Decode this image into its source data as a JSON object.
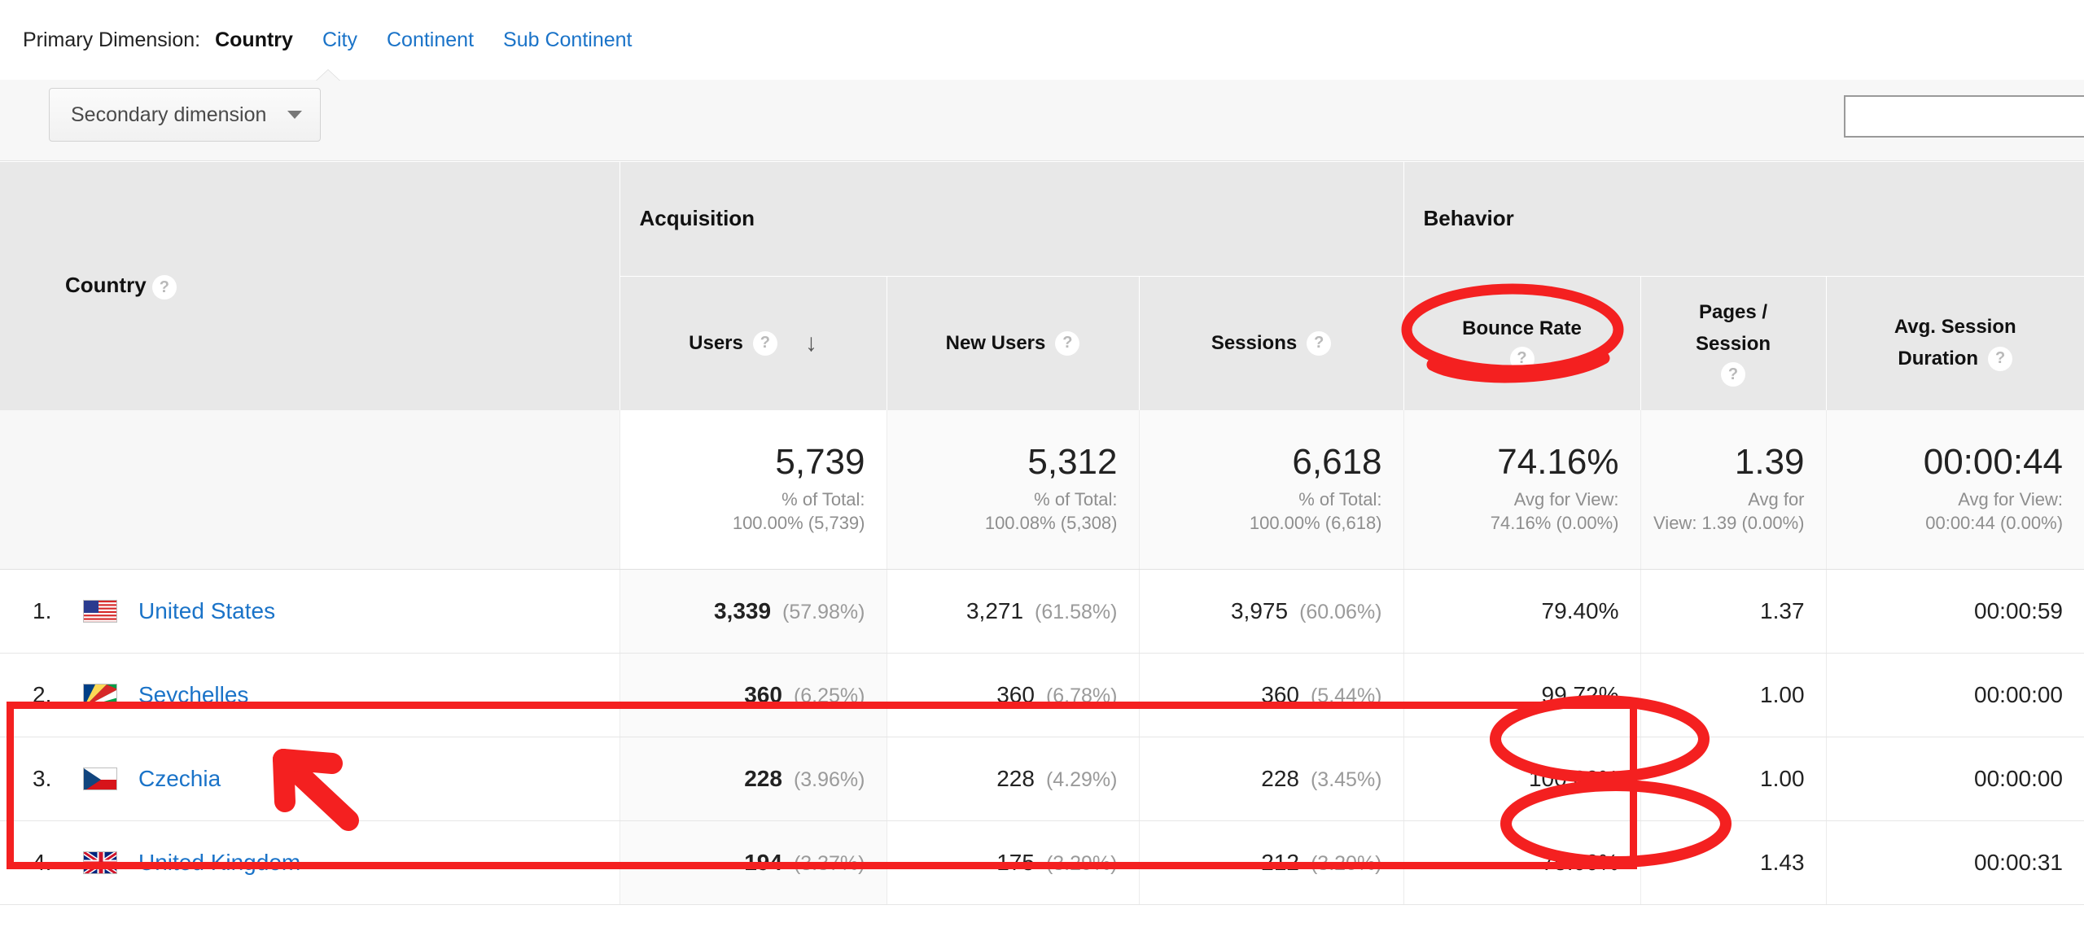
{
  "primary_dimension": {
    "label": "Primary Dimension:",
    "items": [
      {
        "label": "Country",
        "active": true
      },
      {
        "label": "City",
        "active": false
      },
      {
        "label": "Continent",
        "active": false
      },
      {
        "label": "Sub Continent",
        "active": false
      }
    ]
  },
  "toolbar": {
    "secondary_dimension_label": "Secondary dimension",
    "dropdown_icon": "chevron-down-icon",
    "search_value": "",
    "search_placeholder": ""
  },
  "table": {
    "dimension_header": "Country",
    "help_icon": "help-question-icon",
    "sort_icon": "sort-descending-arrow-icon",
    "groups": [
      {
        "label": "Acquisition",
        "span": 3
      },
      {
        "label": "Behavior",
        "span": 3
      }
    ],
    "columns": [
      {
        "label": "Users",
        "help": true,
        "sorted": true
      },
      {
        "label": "New Users",
        "help": true,
        "sorted": false
      },
      {
        "label": "Sessions",
        "help": true,
        "sorted": false
      },
      {
        "label": "Bounce Rate",
        "help": true,
        "sorted": false
      },
      {
        "label": "Pages / Session",
        "line1": "Pages /",
        "line2": "Session",
        "help": true,
        "sorted": false
      },
      {
        "label": "Avg. Session Duration",
        "line1": "Avg. Session",
        "line2": "Duration",
        "help": true,
        "sorted": false
      }
    ],
    "summary": [
      {
        "big": "5,739",
        "sub1": "% of Total:",
        "sub2": "100.00% (5,739)"
      },
      {
        "big": "5,312",
        "sub1": "% of Total:",
        "sub2": "100.08% (5,308)"
      },
      {
        "big": "6,618",
        "sub1": "% of Total:",
        "sub2": "100.00% (6,618)"
      },
      {
        "big": "74.16%",
        "sub1": "Avg for View:",
        "sub2": "74.16% (0.00%)"
      },
      {
        "big": "1.39",
        "sub1": "Avg for",
        "sub2": "View: 1.39 (0.00%)"
      },
      {
        "big": "00:00:44",
        "sub1": "Avg for View:",
        "sub2": "00:00:44 (0.00%)"
      }
    ],
    "rows": [
      {
        "rank": "1.",
        "country": "United States",
        "flag": "flag-united-states",
        "users": "3,339",
        "users_pct": "(57.98%)",
        "new_users": "3,271",
        "new_users_pct": "(61.58%)",
        "sessions": "3,975",
        "sessions_pct": "(60.06%)",
        "bounce_rate": "79.40%",
        "pages_session": "1.37",
        "avg_duration": "00:00:59"
      },
      {
        "rank": "2.",
        "country": "Seychelles",
        "flag": "flag-seychelles",
        "users": "360",
        "users_pct": "(6.25%)",
        "new_users": "360",
        "new_users_pct": "(6.78%)",
        "sessions": "360",
        "sessions_pct": "(5.44%)",
        "bounce_rate": "99.72%",
        "pages_session": "1.00",
        "avg_duration": "00:00:00"
      },
      {
        "rank": "3.",
        "country": "Czechia",
        "flag": "flag-czechia",
        "users": "228",
        "users_pct": "(3.96%)",
        "new_users": "228",
        "new_users_pct": "(4.29%)",
        "sessions": "228",
        "sessions_pct": "(3.45%)",
        "bounce_rate": "100.00%",
        "pages_session": "1.00",
        "avg_duration": "00:00:00"
      },
      {
        "rank": "4.",
        "country": "United Kingdom",
        "flag": "flag-united-kingdom",
        "users": "194",
        "users_pct": "(3.37%)",
        "new_users": "175",
        "new_users_pct": "(3.29%)",
        "sessions": "212",
        "sessions_pct": "(3.20%)",
        "bounce_rate": "75.00%",
        "pages_session": "1.43",
        "avg_duration": "00:00:31"
      }
    ]
  },
  "annotations": {
    "color": "#f42020",
    "items": [
      {
        "type": "ellipse",
        "target": "Bounce Rate column header"
      },
      {
        "type": "rectangle",
        "target": "rows 2 and 3 (Seychelles, Czechia)"
      },
      {
        "type": "arrow",
        "target": "Seychelles row"
      },
      {
        "type": "ellipse",
        "target": "99.72% bounce rate"
      },
      {
        "type": "ellipse",
        "target": "100.00% bounce rate"
      }
    ]
  }
}
